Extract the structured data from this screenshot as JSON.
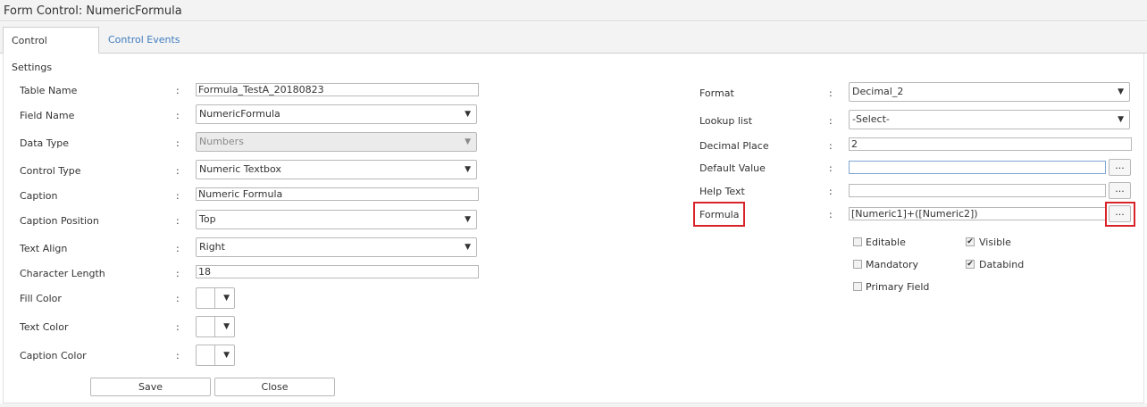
{
  "title": "Form Control: NumericFormula",
  "tabs": [
    {
      "label": "Control Settings",
      "active": true
    },
    {
      "label": "Control Events",
      "active": false
    }
  ],
  "left": {
    "table_name": {
      "label": "Table Name",
      "value": "Formula_TestA_20180823"
    },
    "field_name": {
      "label": "Field Name",
      "value": "NumericFormula"
    },
    "data_type": {
      "label": "Data Type",
      "value": "Numbers"
    },
    "control_type": {
      "label": "Control Type",
      "value": "Numeric Textbox"
    },
    "caption": {
      "label": "Caption",
      "value": "Numeric Formula"
    },
    "caption_position": {
      "label": "Caption Position",
      "value": "Top"
    },
    "text_align": {
      "label": "Text Align",
      "value": "Right"
    },
    "character_length": {
      "label": "Character Length",
      "value": "18"
    },
    "fill_color": {
      "label": "Fill Color"
    },
    "text_color": {
      "label": "Text Color"
    },
    "caption_color": {
      "label": "Caption Color"
    }
  },
  "right": {
    "format": {
      "label": "Format",
      "value": "Decimal_2"
    },
    "lookup_list": {
      "label": "Lookup list",
      "value": "-Select-"
    },
    "decimal_place": {
      "label": "Decimal Place",
      "value": "2"
    },
    "default_value": {
      "label": "Default Value",
      "value": ""
    },
    "help_text": {
      "label": "Help Text",
      "value": ""
    },
    "formula": {
      "label": "Formula",
      "value": "[Numeric1]+([Numeric2])"
    }
  },
  "checkboxes": {
    "editable": {
      "label": "Editable",
      "checked": false
    },
    "visible": {
      "label": "Visible",
      "checked": true
    },
    "mandatory": {
      "label": "Mandatory",
      "checked": false
    },
    "databind": {
      "label": "Databind",
      "checked": true
    },
    "primary_field": {
      "label": "Primary Field",
      "checked": false
    }
  },
  "colon": ":",
  "ellipsis": "...",
  "caret": "▼",
  "check_mark": "✔",
  "buttons": {
    "save": "Save",
    "close": "Close"
  },
  "colors": {
    "accent_link": "#3f7cbf",
    "highlight_red": "#d9232a"
  }
}
